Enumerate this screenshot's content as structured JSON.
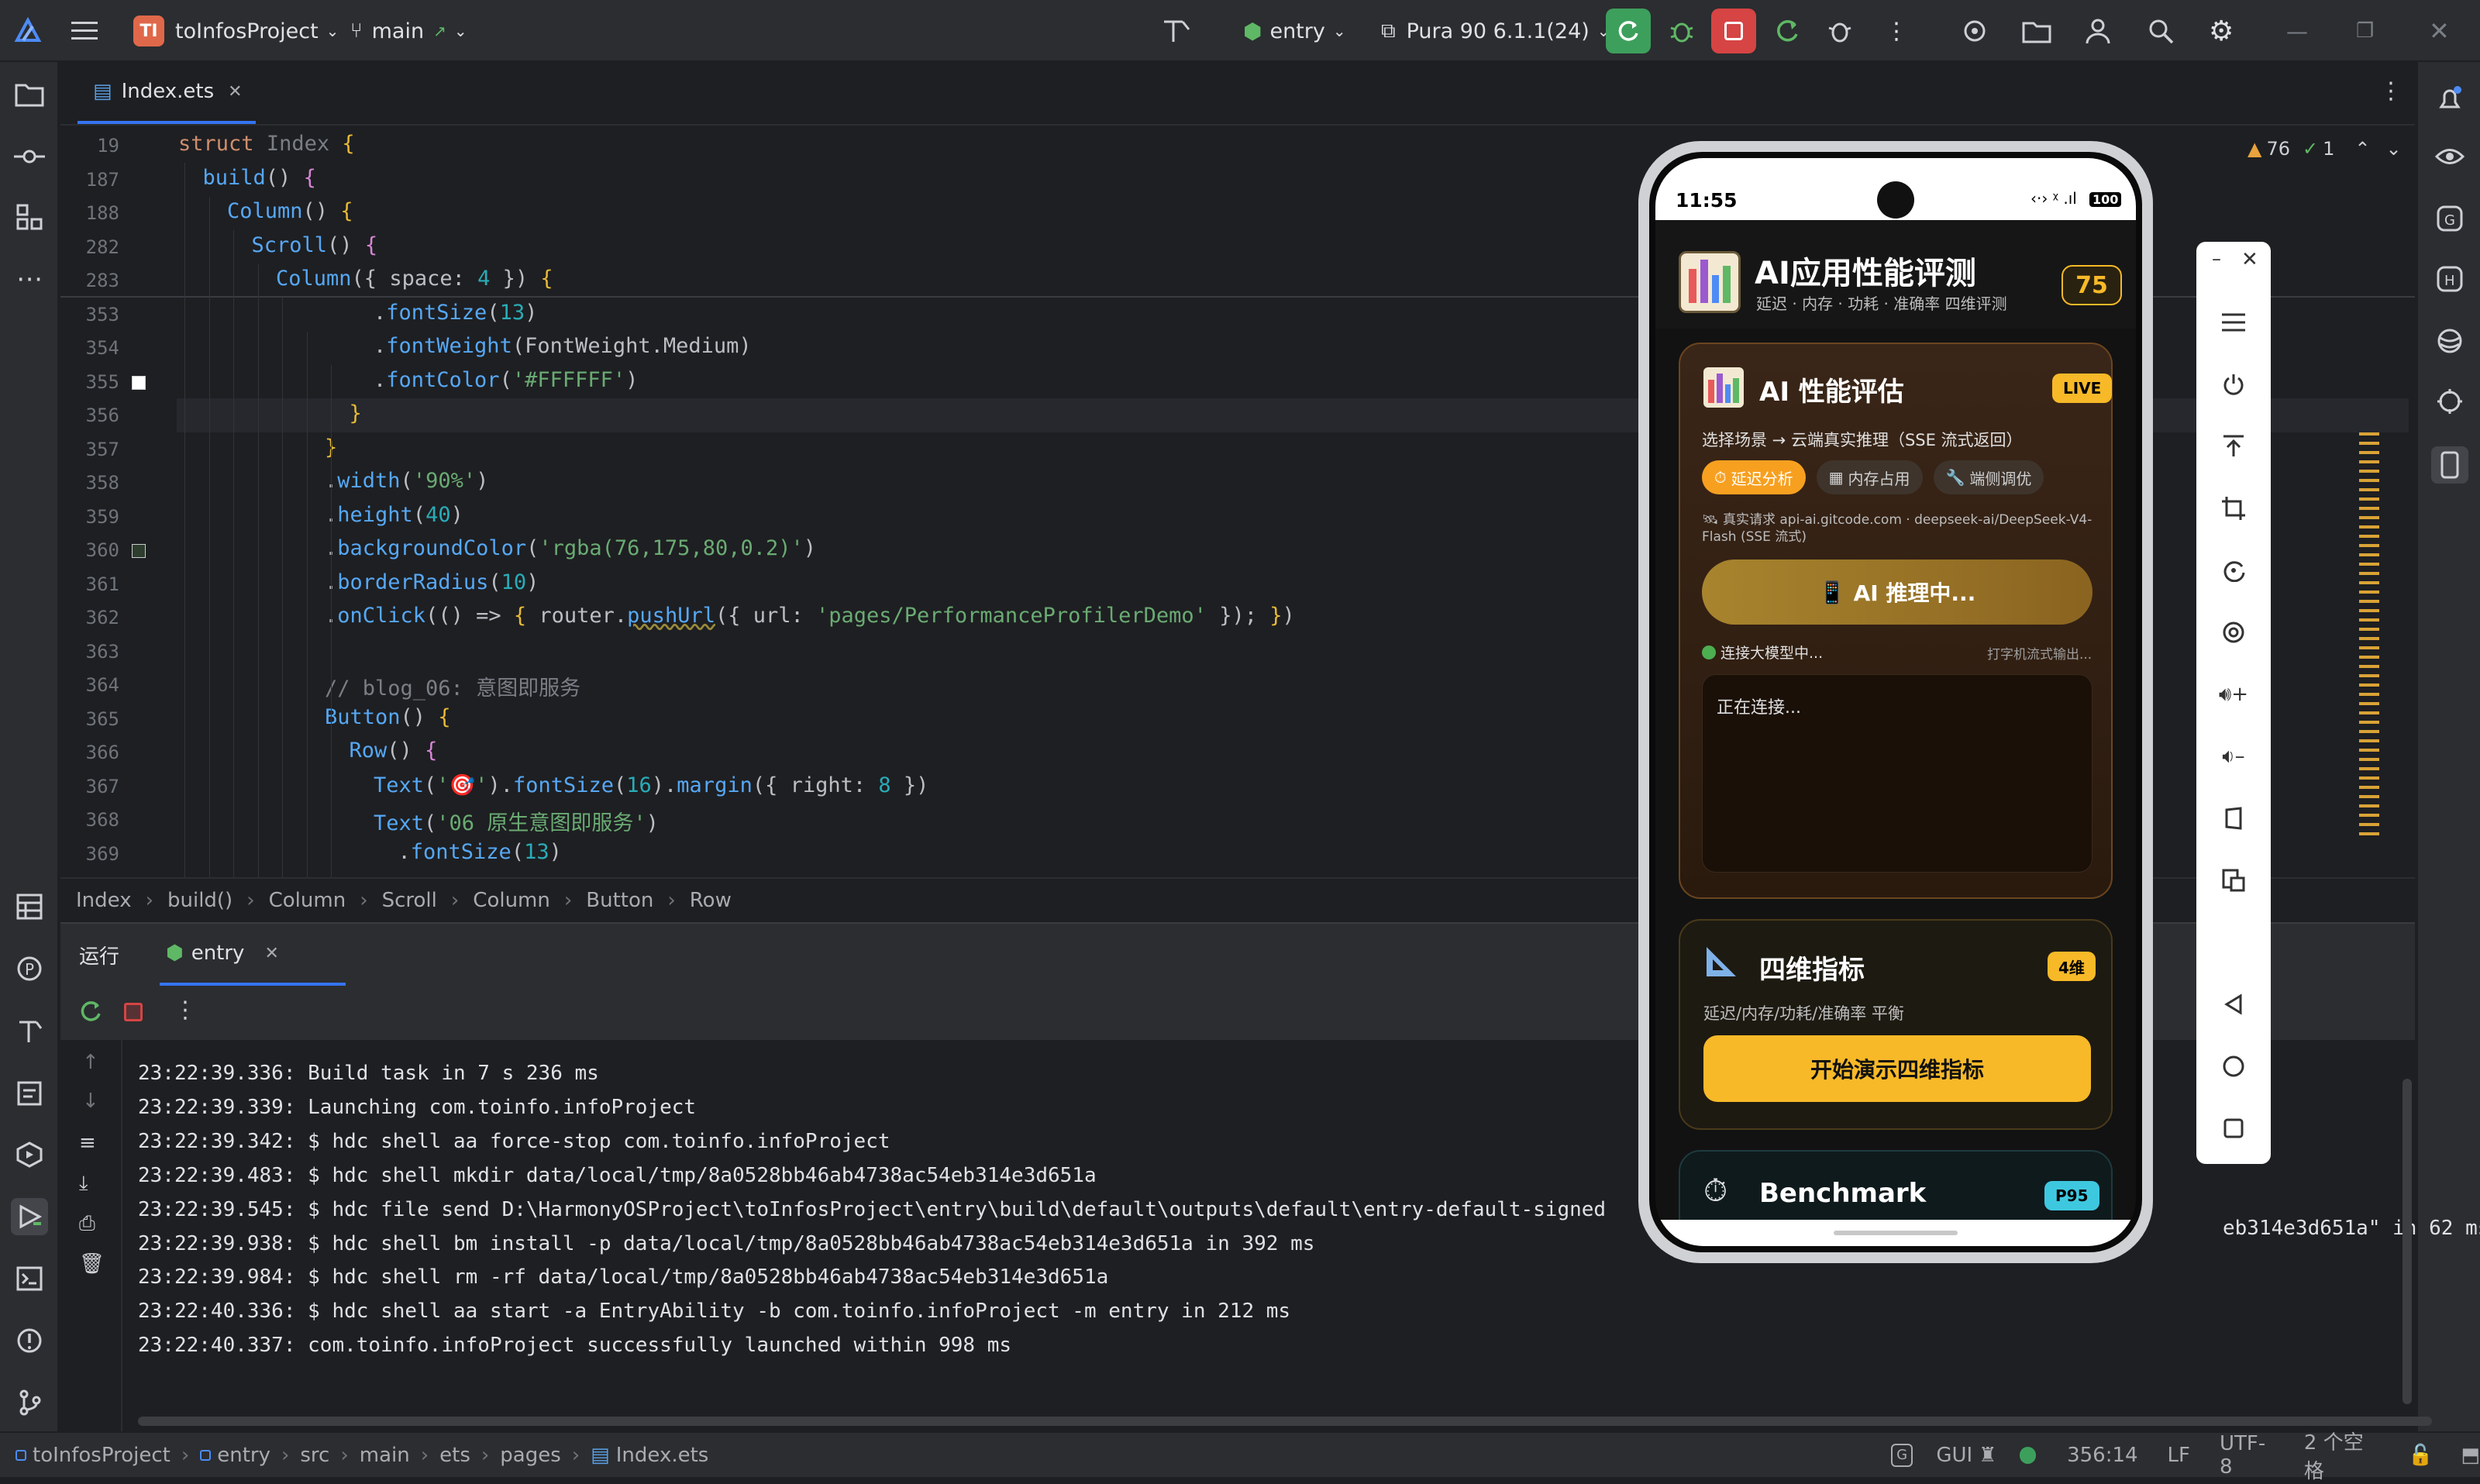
{
  "titlebar": {
    "project_badge": "TI",
    "project_name": "toInfosProject",
    "branch": "main",
    "run_config": "entry",
    "device": "Pura 90 6.1.1(24)"
  },
  "editor": {
    "tab_label": "Index.ets",
    "inspection_warnings": "76",
    "inspection_ok": "1",
    "lines": [
      {
        "n": "19",
        "html": "<span class='kw'>struct</span> <span class='gr'>Index</span> <span class='br'>{</span>",
        "indent": 0
      },
      {
        "n": "187",
        "html": "<span class='fn'>build</span>() <span class='br2'>{</span>",
        "indent": 1
      },
      {
        "n": "188",
        "html": "<span class='fn'>Column</span>() <span class='br'>{</span>",
        "indent": 2
      },
      {
        "n": "282",
        "html": "<span class='fn'>Scroll</span>() <span class='br2'>{</span>",
        "indent": 3
      },
      {
        "n": "283",
        "html": "<span class='fn'>Column</span>({ space: <span class='num'>4</span> }) <span class='br'>{</span>",
        "indent": 4
      },
      {
        "n": "353",
        "html": ".<span class='fn'>fontSize</span>(<span class='num'>13</span>)",
        "indent": 8
      },
      {
        "n": "354",
        "html": ".<span class='fn'>fontWeight</span>(FontWeight.Medium)",
        "indent": 8
      },
      {
        "n": "355",
        "html": ".<span class='fn'>fontColor</span>(<span class='str'>'#FFFFFF'</span>)",
        "indent": 8
      },
      {
        "n": "356",
        "html": "<span class='br'>}</span>",
        "indent": 7
      },
      {
        "n": "357",
        "html": "<span class='br'>}</span>",
        "indent": 6
      },
      {
        "n": "358",
        "html": ".<span class='fn'>width</span>(<span class='str'>'90%'</span>)",
        "indent": 6
      },
      {
        "n": "359",
        "html": ".<span class='fn'>height</span>(<span class='num'>40</span>)",
        "indent": 6
      },
      {
        "n": "360",
        "html": ".<span class='fn'>backgroundColor</span>(<span class='str'>'rgba(76,175,80,0.2)'</span>)",
        "indent": 6
      },
      {
        "n": "361",
        "html": ".<span class='fn'>borderRadius</span>(<span class='num'>10</span>)",
        "indent": 6
      },
      {
        "n": "362",
        "html": ".<span class='fn'>onClick</span>(() => <span class='br'>{</span> router.<span class='fn' style='text-decoration:underline wavy #9a8a3a'>pushUrl</span>({ url: <span class='str'>'pages/PerformanceProfilerDemo'</span> }); <span class='br'>}</span>)",
        "indent": 6
      },
      {
        "n": "363",
        "html": "",
        "indent": 6
      },
      {
        "n": "364",
        "html": "<span class='cmt'>// blog_06: 意图即服务</span>",
        "indent": 6
      },
      {
        "n": "365",
        "html": "<span class='fn'>Button</span>() <span class='br'>{</span>",
        "indent": 6
      },
      {
        "n": "366",
        "html": "<span class='fn'>Row</span>() <span class='br2'>{</span>",
        "indent": 7
      },
      {
        "n": "367",
        "html": "<span class='fn'>Text</span>(<span class='str'>'🎯'</span>).<span class='fn'>fontSize</span>(<span class='num'>16</span>).<span class='fn'>margin</span>({ right: <span class='num'>8</span> })",
        "indent": 8
      },
      {
        "n": "368",
        "html": "<span class='fn'>Text</span>(<span class='str'>'06 原生意图即服务'</span>)",
        "indent": 8
      },
      {
        "n": "369",
        "html": ".<span class='fn'>fontSize</span>(<span class='num'>13</span>)",
        "indent": 9
      }
    ]
  },
  "breadcrumb": [
    "Index",
    "build()",
    "Column",
    "Scroll",
    "Column",
    "Button",
    "Row"
  ],
  "run_panel": {
    "tab_run": "运行",
    "tab_entry": "entry",
    "console": [
      "23:22:39.336: Build task in 7 s 236 ms",
      "23:22:39.339: Launching com.toinfo.infoProject",
      "23:22:39.342: $ hdc shell aa force-stop com.toinfo.infoProject",
      "23:22:39.483: $ hdc shell mkdir data/local/tmp/8a0528bb46ab4738ac54eb314e3d651a",
      "23:22:39.545: $ hdc file send D:\\HarmonyOSProject\\toInfosProject\\entry\\build\\default\\outputs\\default\\entry-default-signed",
      "23:22:39.938: $ hdc shell bm install -p data/local/tmp/8a0528bb46ab4738ac54eb314e3d651a in 392 ms",
      "23:22:39.984: $ hdc shell rm -rf data/local/tmp/8a0528bb46ab4738ac54eb314e3d651a",
      "23:22:40.336: $ hdc shell aa start -a EntryAbility -b com.toinfo.infoProject -m entry in 212 ms",
      "23:22:40.337: com.toinfo.infoProject successfully launched within 998 ms"
    ],
    "console_tail": "eb314e3d651a\" in 62 ms"
  },
  "statusbar": {
    "path": [
      "toInfosProject",
      "entry",
      "src",
      "main",
      "ets",
      "pages",
      "Index.ets"
    ],
    "gui": "GUI",
    "position": "356:14",
    "line_sep": "LF",
    "encoding": "UTF-8",
    "indent": "2 个空格"
  },
  "phone": {
    "time": "11:55",
    "battery": "100",
    "app_title": "AI应用性能评测",
    "app_subtitle": "延迟 · 内存 · 功耗 · 准确率 四维评测",
    "score": "75",
    "card1": {
      "title": "AI 性能评估",
      "badge": "LIVE",
      "desc": "选择场景 → 云端真实推理（SSE 流式返回）",
      "chips": [
        "延迟分析",
        "内存占用",
        "端侧调优"
      ],
      "request_info": "🛰 真实请求 api-ai.gitcode.com · deepseek-ai/DeepSeek-V4-Flash (SSE 流式)",
      "button": "AI 推理中...",
      "status_left": "连接大模型中...",
      "status_right": "打字机流式输出...",
      "output": "正在连接..."
    },
    "card2": {
      "title": "四维指标",
      "badge": "4维",
      "desc": "延迟/内存/功耗/准确率 平衡",
      "button": "开始演示四维指标"
    },
    "card3": {
      "title": "Benchmark",
      "badge": "P95"
    }
  },
  "colors": {
    "accent_yellow": "#f7b928",
    "ide_bg": "#1e1f22",
    "panel_bg": "#2b2d30"
  }
}
